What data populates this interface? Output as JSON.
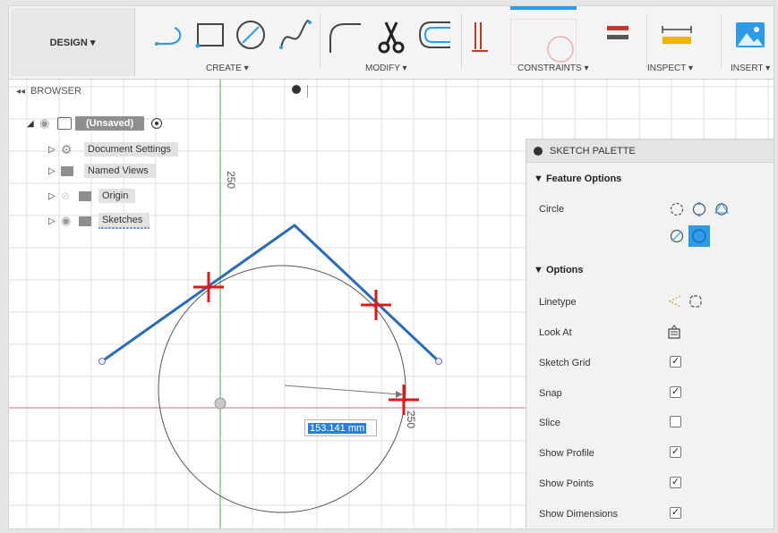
{
  "toolbar": {
    "design_label": "DESIGN ▾",
    "groups": [
      {
        "label": "CREATE ▾"
      },
      {
        "label": "MODIFY ▾"
      },
      {
        "label": "CONSTRAINTS ▾"
      },
      {
        "label": "INSPECT ▾"
      },
      {
        "label": "INSERT ▾"
      }
    ],
    "icons": [
      "line-icon",
      "rectangle-icon",
      "circle-icon",
      "spline-icon",
      "fillet-icon",
      "trim-icon",
      "offset-icon",
      "coincident-constraint-icon",
      "tangent-constraint-icon",
      "equal-constraint-icon",
      "measure-icon",
      "insert-image-icon"
    ]
  },
  "browser": {
    "title": "BROWSER",
    "root_label": "(Unsaved)",
    "items": [
      {
        "label": "Document Settings",
        "icon": "gear-icon"
      },
      {
        "label": "Named Views",
        "icon": "folder-icon"
      },
      {
        "label": "Origin",
        "icon": "folder-icon"
      },
      {
        "label": "Sketches",
        "icon": "folder-icon"
      }
    ]
  },
  "canvas": {
    "dim_vertical": "250",
    "dim_horizontal": "250",
    "dimension_value": "153.141 mm",
    "colors": {
      "sketch_line": "#2a6bb5",
      "marker": "#d9191c",
      "grid": "#dcdcdc",
      "axis_green": "#7fcf7f",
      "axis_red": "#c87878"
    }
  },
  "palette": {
    "title": "SKETCH PALETTE",
    "feature_options_title": "▼ Feature Options",
    "circle_label": "Circle",
    "circle_tools": [
      "center-diameter-circle-icon",
      "two-point-circle-icon",
      "three-point-circle-icon",
      "two-tangent-circle-icon",
      "three-tangent-circle-icon"
    ],
    "options_title": "▼ Options",
    "options": [
      {
        "label": "Linetype",
        "control": "linetype-icons"
      },
      {
        "label": "Look At",
        "control": "look-at-icon"
      },
      {
        "label": "Sketch Grid",
        "checked": true
      },
      {
        "label": "Snap",
        "checked": true
      },
      {
        "label": "Slice",
        "checked": false
      },
      {
        "label": "Show Profile",
        "checked": true
      },
      {
        "label": "Show Points",
        "checked": true
      },
      {
        "label": "Show Dimensions",
        "checked": true
      }
    ],
    "check_mark": "✓"
  },
  "accent_color": "#2e9be6"
}
